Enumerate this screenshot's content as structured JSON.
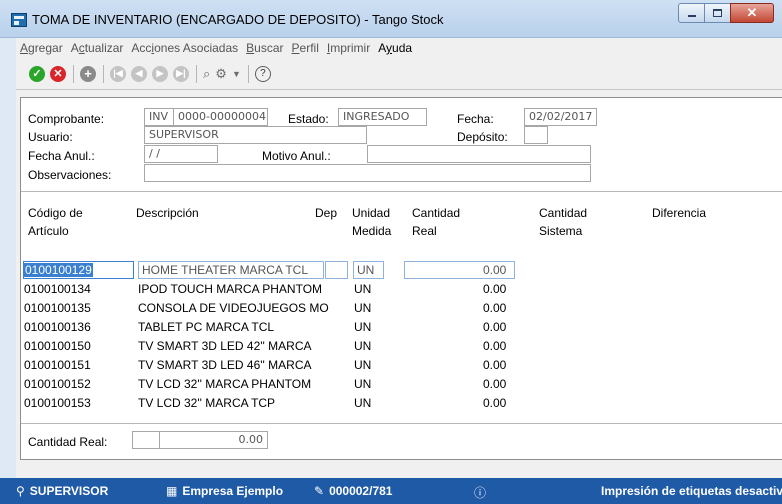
{
  "window": {
    "title": "TOMA DE INVENTARIO (ENCARGADO DE DEPOSITO) - Tango Stock"
  },
  "menu": [
    {
      "pre": "",
      "u": "A",
      "post": "gregar",
      "enabled": false
    },
    {
      "pre": "A",
      "u": "c",
      "post": "tualizar",
      "enabled": false
    },
    {
      "pre": "Acc",
      "u": "i",
      "post": "ones Asociadas",
      "enabled": false
    },
    {
      "pre": "",
      "u": "B",
      "post": "uscar",
      "enabled": false
    },
    {
      "pre": "",
      "u": "P",
      "post": "erfil",
      "enabled": false
    },
    {
      "pre": "",
      "u": "I",
      "post": "mprimir",
      "enabled": false
    },
    {
      "pre": "A",
      "u": "y",
      "post": "uda",
      "enabled": true
    }
  ],
  "form": {
    "comprobante_label": "Comprobante:",
    "comprobante_tipo": "INV",
    "comprobante_num": "0000-00000004",
    "estado_label": "Estado:",
    "estado_value": "INGRESADO",
    "fecha_label": "Fecha:",
    "fecha_value": "02/02/2017",
    "usuario_label": "Usuario:",
    "usuario_value": "SUPERVISOR",
    "deposito_label": "Depósito:",
    "deposito_value": "",
    "fecha_anul_label": "Fecha Anul.:",
    "fecha_anul_value": " / /",
    "motivo_anul_label": "Motivo Anul.:",
    "motivo_anul_value": "",
    "observaciones_label": "Observaciones:",
    "observaciones_value": ""
  },
  "table": {
    "headers": {
      "codigo_1": "Código de",
      "codigo_2": "Artículo",
      "descripcion": "Descripción",
      "dep": "Dep",
      "unidad_1": "Unidad",
      "unidad_2": "Medida",
      "cant_real_1": "Cantidad",
      "cant_real_2": "Real",
      "cant_sist_1": "Cantidad",
      "cant_sist_2": "Sistema",
      "diferencia": "Diferencia"
    },
    "rows": [
      {
        "code": "0100100129",
        "desc": "HOME THEATER MARCA TCL",
        "unit": "UN",
        "qty": "0.00"
      },
      {
        "code": "0100100134",
        "desc": "IPOD TOUCH MARCA PHANTOM",
        "unit": "UN",
        "qty": "0.00"
      },
      {
        "code": "0100100135",
        "desc": "CONSOLA DE VIDEOJUEGOS MO",
        "unit": "UN",
        "qty": "0.00"
      },
      {
        "code": "0100100136",
        "desc": "TABLET PC  MARCA TCL",
        "unit": "UN",
        "qty": "0.00"
      },
      {
        "code": "0100100150",
        "desc": "TV SMART 3D LED 42'' MARCA",
        "unit": "UN",
        "qty": "0.00"
      },
      {
        "code": "0100100151",
        "desc": "TV SMART 3D LED 46'' MARCA",
        "unit": "UN",
        "qty": "0.00"
      },
      {
        "code": "0100100152",
        "desc": "TV LCD 32'' MARCA PHANTOM",
        "unit": "UN",
        "qty": "0.00"
      },
      {
        "code": "0100100153",
        "desc": "TV LCD 32'' MARCA TCP",
        "unit": "UN",
        "qty": "0.00"
      }
    ]
  },
  "footer": {
    "cantidad_real_label": "Cantidad Real:",
    "cantidad_real_value": "0.00"
  },
  "status": {
    "user": "SUPERVISOR",
    "company": "Empresa Ejemplo",
    "code": "000002/781",
    "message": "Impresión de etiquetas desactiva"
  }
}
